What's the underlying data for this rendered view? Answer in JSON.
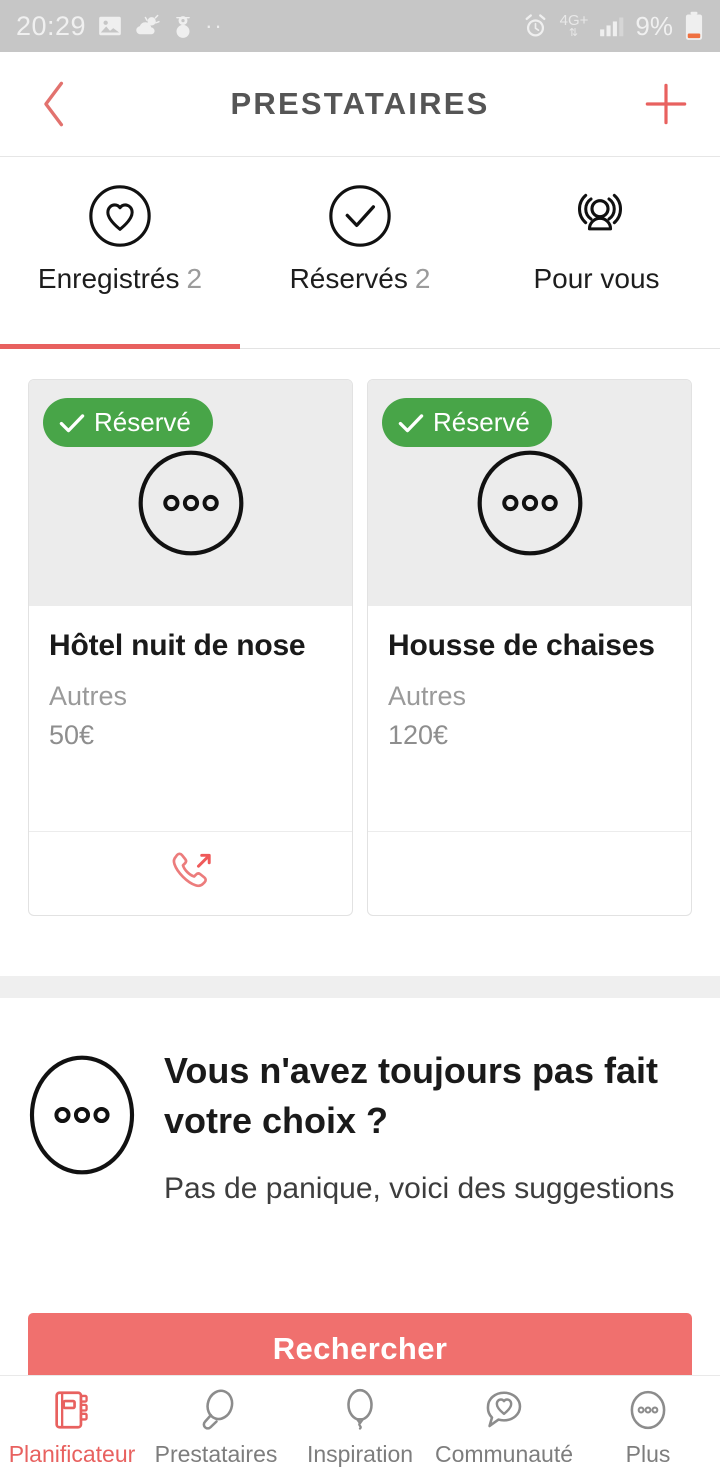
{
  "status_bar": {
    "time": "20:29",
    "icons_left": [
      "photo-icon",
      "weather-icon",
      "snowman-icon",
      "two-dots-icon"
    ],
    "alarm": "alarm-icon",
    "network": "4G+",
    "signal": "signal-bars-icon",
    "battery_percent": "9%",
    "battery": "battery-low-icon",
    "bg_color": "#c6c6c6"
  },
  "header": {
    "back_label": "back-chevron",
    "title": "PRESTATAIRES",
    "add_label": "plus",
    "accent_color": "#e8615f",
    "title_color": "#555555"
  },
  "tabs": {
    "active_index": 0,
    "underline_color": "#e8615f",
    "items": [
      {
        "label": "Enregistrés",
        "count": "2",
        "icon": "heart-circle-icon"
      },
      {
        "label": "Réservés",
        "count": "2",
        "icon": "check-circle-icon"
      },
      {
        "label": "Pour vous",
        "count": "",
        "icon": "person-broadcast-icon"
      }
    ]
  },
  "cards": [
    {
      "badge": "Réservé",
      "badge_color": "#48a548",
      "title": "Hôtel nuit de nose",
      "category": "Autres",
      "price": "50€",
      "image": "ellipsis-circle-placeholder",
      "has_call_action": true,
      "call_icon": "phone-outgoing-icon"
    },
    {
      "badge": "Réservé",
      "badge_color": "#48a548",
      "title": "Housse de chaises",
      "category": "Autres",
      "price": "120€",
      "image": "ellipsis-circle-placeholder",
      "has_call_action": false,
      "call_icon": ""
    }
  ],
  "promo": {
    "icon": "ellipsis-oval-icon",
    "title": "Vous n'avez toujours pas fait votre choix ?",
    "subtitle": "Pas de panique, voici des suggestions"
  },
  "cta": {
    "label": "Rechercher",
    "bg_color": "#f0706e"
  },
  "bottom_nav": {
    "active_index": 0,
    "active_color": "#e8615f",
    "items": [
      {
        "label": "Planificateur",
        "icon": "planner-book-icon"
      },
      {
        "label": "Prestataires",
        "icon": "magnifier-icon"
      },
      {
        "label": "Inspiration",
        "icon": "balloon-icon"
      },
      {
        "label": "Communauté",
        "icon": "speech-heart-icon"
      },
      {
        "label": "Plus",
        "icon": "ellipsis-oval-icon"
      }
    ]
  }
}
